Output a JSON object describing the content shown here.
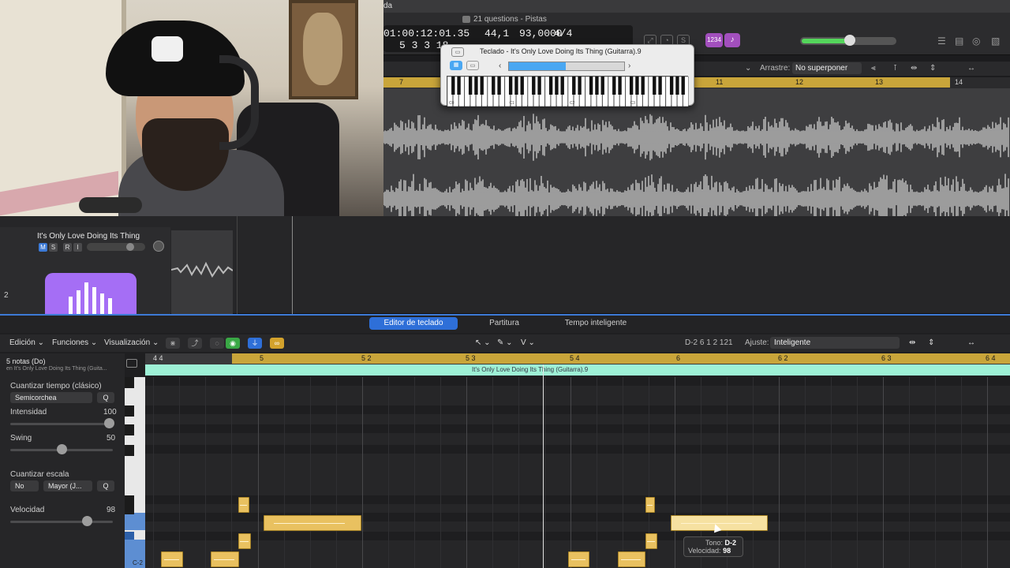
{
  "window": {
    "title": "21 questions - Pistas",
    "menu_fragment": "da"
  },
  "lcd": {
    "time": "01:00:12:01.35",
    "bars": "5 3 3 18",
    "bpm_prefix": "44,1",
    "tempo": "93,0000",
    "signature": "4/4"
  },
  "controls": {
    "count_in": "1234"
  },
  "tracks_toolbar": {
    "drag_label": "Arrastre:",
    "drag_value": "No superponer"
  },
  "arrange_ruler": [
    "7",
    "11",
    "12",
    "13",
    "14"
  ],
  "track": {
    "name": "It's Only Love Doing Its Thing",
    "number": "2",
    "buttons": [
      "M",
      "S",
      "R",
      "I"
    ]
  },
  "keyboard_window": {
    "title": "Teclado - It's Only Love Doing Its Thing (Guitarra).9",
    "octave_labels": [
      "C0",
      "C1",
      "C2",
      "C3"
    ]
  },
  "editor": {
    "tabs": [
      "Editor de teclado",
      "Partitura",
      "Tempo inteligente"
    ],
    "active_tab": 0,
    "menus": [
      "Edición",
      "Funciones",
      "Visualización"
    ],
    "position_readout": "D-2   6 1 2 121",
    "snap_label": "Ajuste:",
    "snap_value": "Inteligente",
    "notes_count": "5 notas (Do)",
    "notes_region": "en It's Only Love Doing Its Thing (Guita...",
    "ruler": [
      "4 4",
      "5",
      "5 2",
      "5 3",
      "5 4",
      "6",
      "6 2",
      "6 3",
      "6 4"
    ],
    "region_name": "It's Only Love Doing Its Thing (Guitarra).9",
    "key_label": "C-2"
  },
  "inspector": {
    "quantize_time_label": "Cuantizar tiempo (clásico)",
    "quantize_value": "Semicorchea",
    "q_button": "Q",
    "strength_label": "Intensidad",
    "strength_value": "100",
    "swing_label": "Swing",
    "swing_value": "50",
    "scale_label": "Cuantizar escala",
    "scale_root": "No",
    "scale_type": "Mayor (J...",
    "velocity_label": "Velocidad",
    "velocity_value": "98"
  },
  "tooltip": {
    "pitch_label": "Tono:",
    "pitch_value": "D-2",
    "velocity_label": "Velocidad:",
    "velocity_value": "98"
  },
  "colors": {
    "accent_blue": "#2e6fd8",
    "cycle_gold": "#c9a53a",
    "note_fill": "#e9c160",
    "region_cyan": "#9ef1d6",
    "track_purple": "#a56ef5"
  }
}
